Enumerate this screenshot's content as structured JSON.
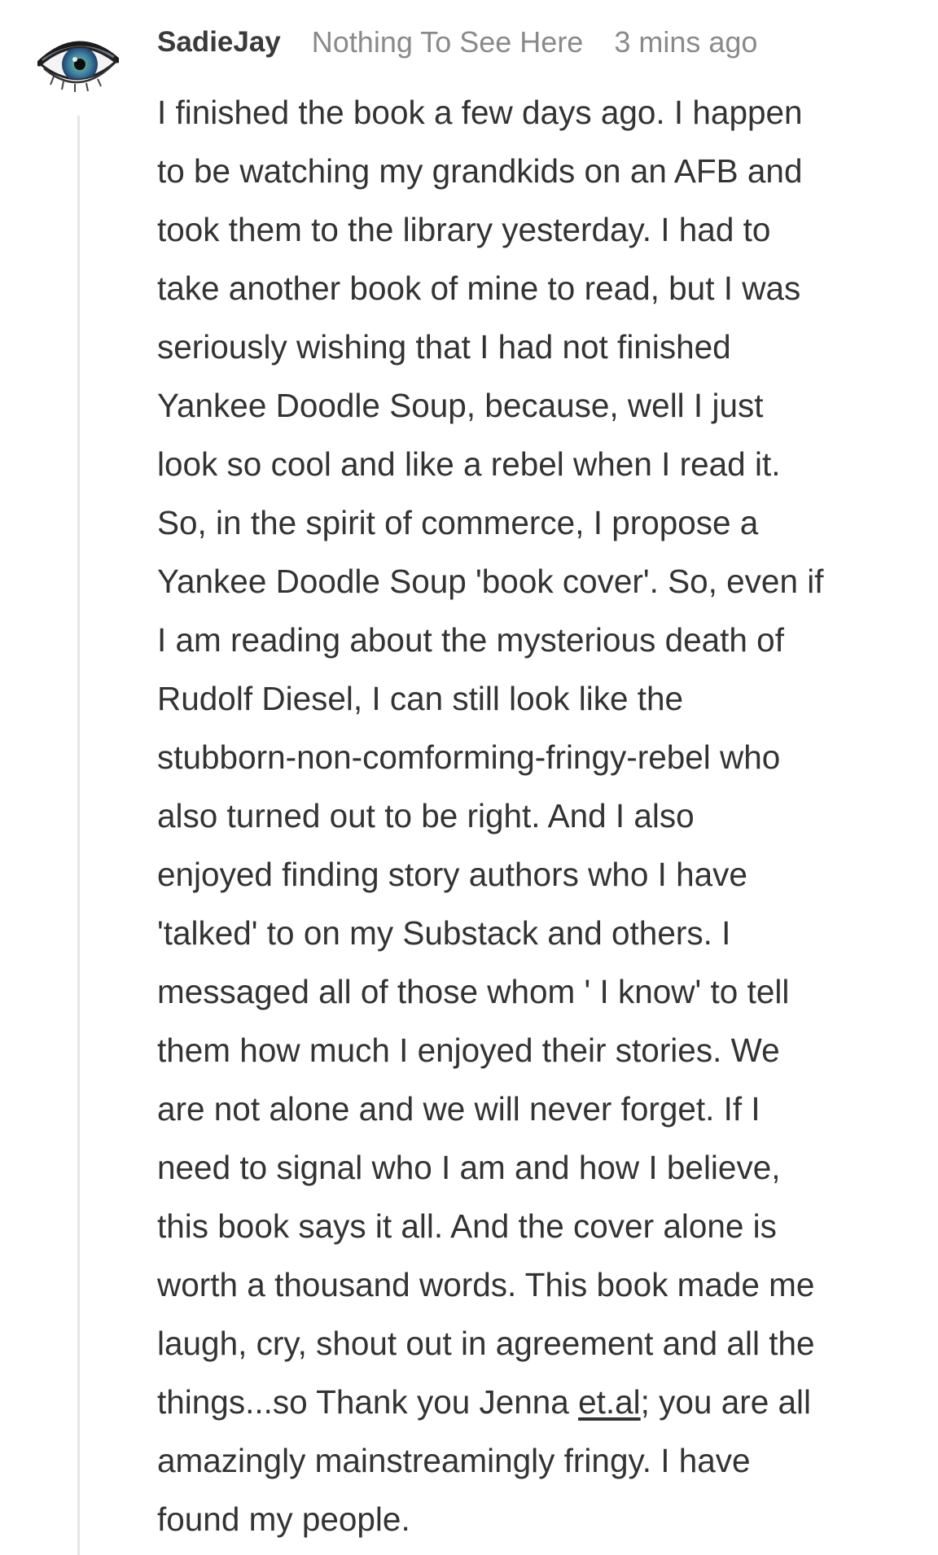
{
  "comment": {
    "author": "SadieJay",
    "publication": "Nothing To See Here",
    "timestamp": "3 mins ago",
    "avatar_icon": "eye-avatar",
    "body_lines": [
      "I finished the book a few days ago. I happen",
      "to be watching my grandkids on an AFB and",
      "took them to the library yesterday. I had to",
      "take another book of mine to read, but I was",
      "seriously wishing that I had not finished",
      "Yankee Doodle Soup, because, well I just",
      "look so cool and like a rebel when I read it.",
      "So, in the spirit of commerce, I propose a",
      "Yankee Doodle Soup 'book cover'. So, even if",
      "I am reading about the mysterious death of",
      "Rudolf Diesel, I can still look like the",
      "stubborn-non-comforming-fringy-rebel who",
      "also turned out to be right. And I also",
      "enjoyed finding story authors who I have",
      "'talked' to on my Substack and others. I",
      "messaged all of those whom ' I know' to tell",
      "them how much I enjoyed their stories. We",
      "are not alone and we will never forget. If I",
      "need to signal who I am and how I believe,",
      "this book says it all. And the cover alone is",
      "worth a thousand words. This book made me",
      "laugh, cry, shout out in agreement and all the"
    ],
    "link_line": {
      "before": "things...so Thank you Jenna ",
      "link": "et.al",
      "after": "; you are all"
    },
    "tail_lines": [
      "amazingly mainstreamingly fringy. I have",
      "found my people."
    ]
  },
  "colors": {
    "text": "#333333",
    "meta": "#8a8a8a",
    "thread_line": "#e6e6e6",
    "iris": "#3f7fa8"
  }
}
